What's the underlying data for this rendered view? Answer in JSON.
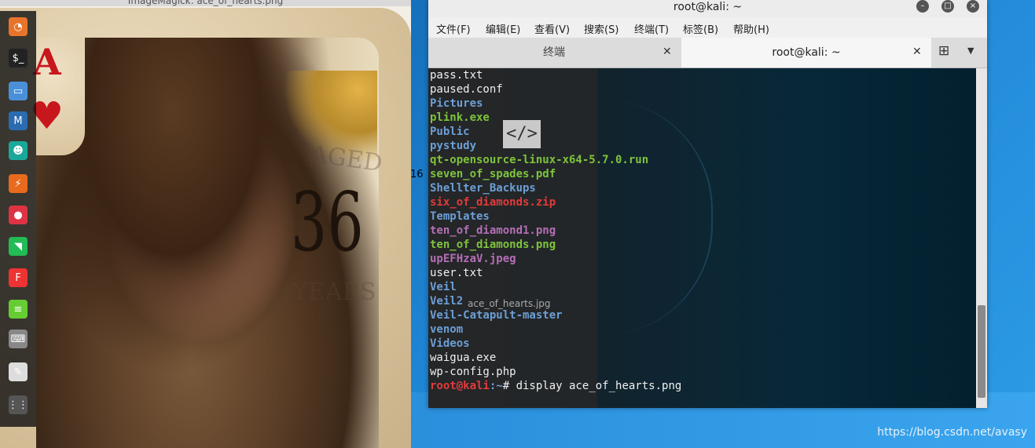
{
  "viewer": {
    "title": "ImageMagick: ace_of_hearts.png",
    "card_rank": "A",
    "card_suit": "♥",
    "aged_text": "AGED",
    "age_number": "36",
    "years_text": "YEARS"
  },
  "left_number": "16",
  "dock": {
    "items": [
      {
        "name": "firefox-icon",
        "glyph": "◔",
        "color": "#e8742b"
      },
      {
        "name": "terminal-icon",
        "glyph": "$_",
        "color": "#222"
      },
      {
        "name": "files-icon",
        "glyph": "▭",
        "color": "#4a90d9"
      },
      {
        "name": "metasploit-icon",
        "glyph": "M",
        "color": "#2b6cb0"
      },
      {
        "name": "armitage-icon",
        "glyph": "☻",
        "color": "#1aa89a"
      },
      {
        "name": "burpsuite-icon",
        "glyph": "⚡",
        "color": "#e86a1c"
      },
      {
        "name": "maltego-icon",
        "glyph": "●",
        "color": "#d34"
      },
      {
        "name": "beef-icon",
        "glyph": "◥",
        "color": "#2b5"
      },
      {
        "name": "faraday-icon",
        "glyph": "F",
        "color": "#e33"
      },
      {
        "name": "leafpad-icon",
        "glyph": "≡",
        "color": "#6c3"
      },
      {
        "name": "keyboard-icon",
        "glyph": "⌨",
        "color": "#888"
      },
      {
        "name": "cutycapt-icon",
        "glyph": "✎",
        "color": "#ddd"
      },
      {
        "name": "app-grid-icon",
        "glyph": "⋮⋮",
        "color": "#555"
      }
    ]
  },
  "terminal": {
    "window_title": "root@kali: ~",
    "menu": [
      "文件(F)",
      "编辑(E)",
      "查看(V)",
      "搜索(S)",
      "终端(T)",
      "标签(B)",
      "帮助(H)"
    ],
    "tabs": [
      {
        "label": "终端",
        "active": false
      },
      {
        "label": "root@kali: ~",
        "active": true
      }
    ],
    "ghost_label": "ace_of_hearts.jpg",
    "lines": [
      {
        "text": "pass.txt",
        "color": "white"
      },
      {
        "text": "paused.conf",
        "color": "white"
      },
      {
        "text": "Pictures",
        "color": "blue"
      },
      {
        "text": "plink.exe",
        "color": "green"
      },
      {
        "text": "Public",
        "color": "blue"
      },
      {
        "text": "pystudy",
        "color": "blue"
      },
      {
        "text": "qt-opensource-linux-x64-5.7.0.run",
        "color": "green"
      },
      {
        "text": "seven_of_spades.pdf",
        "color": "green"
      },
      {
        "text": "Shellter_Backups",
        "color": "blue"
      },
      {
        "text": "six_of_diamonds.zip",
        "color": "red"
      },
      {
        "text": "Templates",
        "color": "blue"
      },
      {
        "text": "ten_of_diamond1.png",
        "color": "purple"
      },
      {
        "text": "ten_of_diamonds.png",
        "color": "green"
      },
      {
        "text": "upEFHzaV.jpeg",
        "color": "purple"
      },
      {
        "text": "user.txt",
        "color": "white"
      },
      {
        "text": "Veil",
        "color": "blue"
      },
      {
        "text": "Veil2",
        "color": "blue"
      },
      {
        "text": "Veil-Catapult-master",
        "color": "blue"
      },
      {
        "text": "venom",
        "color": "blue"
      },
      {
        "text": "Videos",
        "color": "blue"
      },
      {
        "text": "waigua.exe",
        "color": "white"
      },
      {
        "text": "wp-config.php",
        "color": "white"
      }
    ],
    "prompt_user": "root@kali",
    "prompt_path": ":~",
    "prompt_symbol": "# ",
    "command": "display ace_of_hearts.png"
  },
  "watermark": "https://blog.csdn.net/avasy"
}
